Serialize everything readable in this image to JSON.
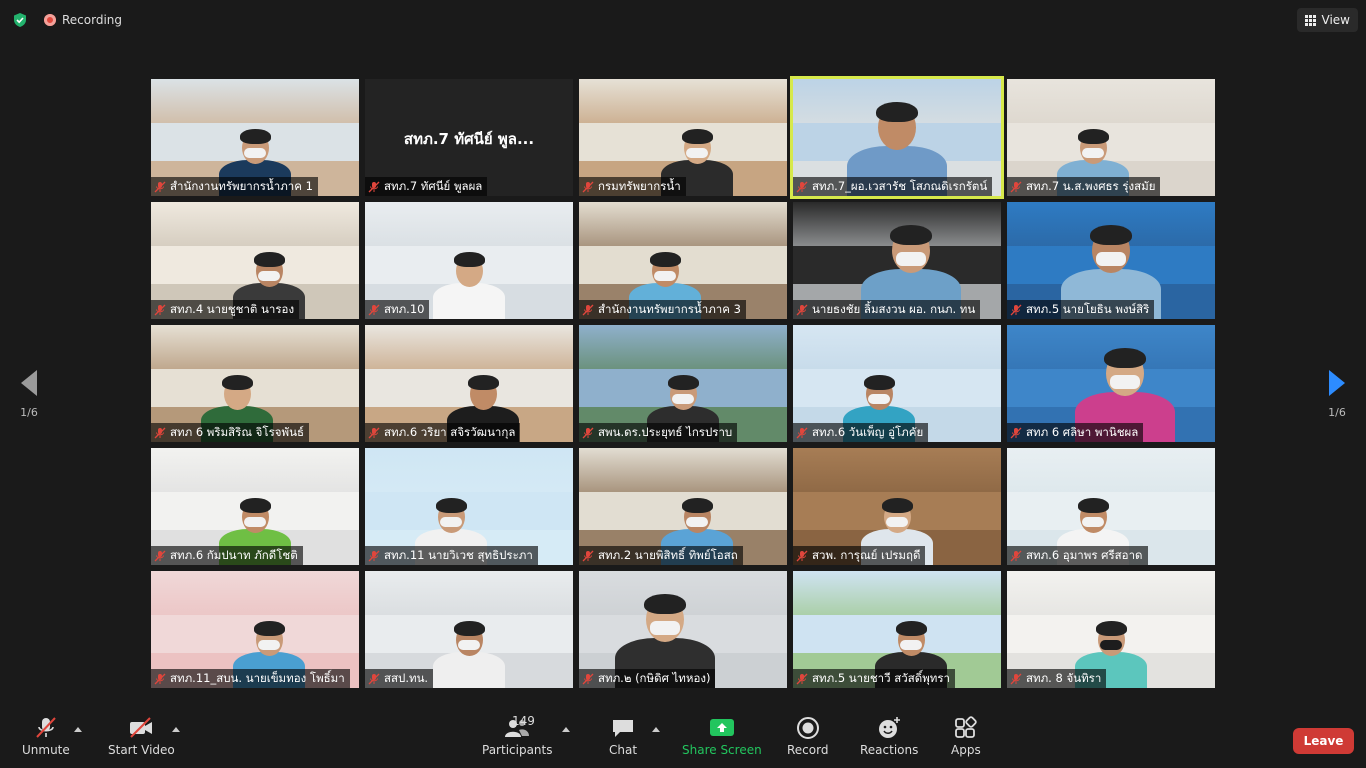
{
  "topbar": {
    "recording_label": "Recording",
    "view_label": "View"
  },
  "pager": {
    "left_label": "1/6",
    "right_label": "1/6"
  },
  "participants_grid": [
    {
      "name": "สำนักงานทรัพยากรน้ำภาค 1",
      "video_on": true
    },
    {
      "name": "สทภ.7 ทัศนีย์  พูลผล",
      "video_on": false,
      "screen_name": "สทภ.7 ทัศนีย์  พูล..."
    },
    {
      "name": "กรมทรัพยากรน้ำ",
      "video_on": true
    },
    {
      "name": "สทภ.7_ผอ.เวสารัช โสภณดิเรกรัตน์",
      "video_on": true,
      "active_speaker": true
    },
    {
      "name": "สทภ.7 น.ส.พงศธร รุ่งสมัย",
      "video_on": true
    },
    {
      "name": "สทภ.4 นายชูชาติ นารอง",
      "video_on": true
    },
    {
      "name": "สทภ.10",
      "video_on": true
    },
    {
      "name": "สำนักงานทรัพยากรน้ำภาค 3",
      "video_on": true
    },
    {
      "name": "นายธงชัย ลิ้มสงวน ผอ. กนภ. ทน",
      "video_on": true
    },
    {
      "name": "สทภ.5 นายโยธิน พงษ์สิริ",
      "video_on": true
    },
    {
      "name": "สทภ 6 พริมสิริณ จิโรจพันธ์",
      "video_on": true
    },
    {
      "name": "สทภ.6 วริยา สจิรวัฒนากุล",
      "video_on": true
    },
    {
      "name": "สพน.ดร.ประยุทธ์  ไกรปราบ",
      "video_on": true
    },
    {
      "name": "สทภ.6 วันเพ็ญ อู่โภคัย",
      "video_on": true
    },
    {
      "name": "สทภ 6 ศลิษา พานิชผล",
      "video_on": true
    },
    {
      "name": "สทภ.6 กัมปนาท ภักดีโชติ",
      "video_on": true
    },
    {
      "name": "สทภ.11 นายวิเวช สุทธิประภา",
      "video_on": true
    },
    {
      "name": "สทภ.2 นายพิสิทธิ์ ทิพย์โอสถ",
      "video_on": true
    },
    {
      "name": "สวพ. การุณย์ เปรมฤดี",
      "video_on": true
    },
    {
      "name": "สทภ.6 อุมาพร ศรีสอาด",
      "video_on": true
    },
    {
      "name": "สทภ.11_สบน. นายเข็มทอง โพธิ์มา",
      "video_on": true
    },
    {
      "name": "สสป.ทน.",
      "video_on": true
    },
    {
      "name": "สทภ.๒ (กษิดิศ  ไทหอง)",
      "video_on": true
    },
    {
      "name": "สทภ.5 นายชาวี สวัสดิ์พุทรา",
      "video_on": true
    },
    {
      "name": "สทภ. 8 จันทิรา",
      "video_on": true
    }
  ],
  "toolbar": {
    "unmute_label": "Unmute",
    "start_video_label": "Start Video",
    "participants_label": "Participants",
    "participants_count": "149",
    "chat_label": "Chat",
    "share_screen_label": "Share Screen",
    "record_label": "Record",
    "reactions_label": "Reactions",
    "apps_label": "Apps",
    "leave_label": "Leave"
  },
  "colors": {
    "background": "#1a1a1a",
    "active_speaker_border": "#d7e94b",
    "share_screen_green": "#22c55e",
    "leave_red": "#cf3a35",
    "pager_blue": "#2d8cff",
    "mic_off_red": "#e0463c"
  }
}
